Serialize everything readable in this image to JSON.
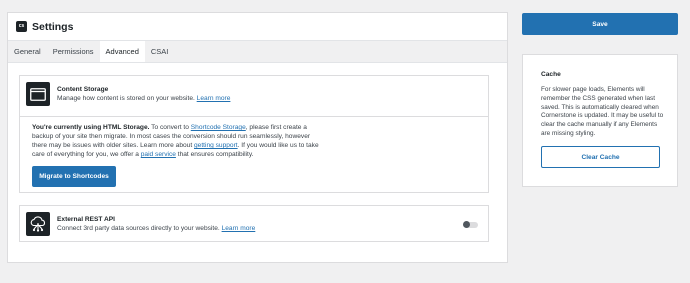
{
  "header": {
    "title": "Settings",
    "logo_text": "cs"
  },
  "tabs": [
    {
      "label": "General",
      "active": false
    },
    {
      "label": "Permissions",
      "active": false
    },
    {
      "label": "Advanced",
      "active": true
    },
    {
      "label": "CSAI",
      "active": false
    }
  ],
  "content_storage": {
    "title": "Content Storage",
    "description": "Manage how content is stored on your website.",
    "learn_more": "Learn more",
    "body_bold": "You're currently using HTML Storage.",
    "body_p1": " To convert to ",
    "body_link1": "Shortcode Storage",
    "body_p2": ", please first create a backup of your site then migrate. In most cases the conversion should run seamlessly, however there may be issues with older sites. Learn more about ",
    "body_link2": "getting support",
    "body_p3": ". If you would like us to take care of everything for you, we offer a ",
    "body_link3": "paid service",
    "body_p4": " that ensures compatibility.",
    "button_label": "Migrate to Shortcodes"
  },
  "rest_api": {
    "title": "External REST API",
    "description": "Connect 3rd party data sources directly to your website.",
    "learn_more": "Learn more",
    "enabled": false
  },
  "sidebar": {
    "save_label": "Save",
    "cache_title": "Cache",
    "cache_text": "For slower page loads, Elements will remember the CSS generated when last saved. This is automatically cleared when Cornerstone is updated. It may be useful to clear the cache manually if any Elements are missing styling.",
    "clear_label": "Clear Cache"
  },
  "colors": {
    "accent": "#2271b1",
    "background": "#f0f0f1",
    "dark": "#1d2327"
  }
}
